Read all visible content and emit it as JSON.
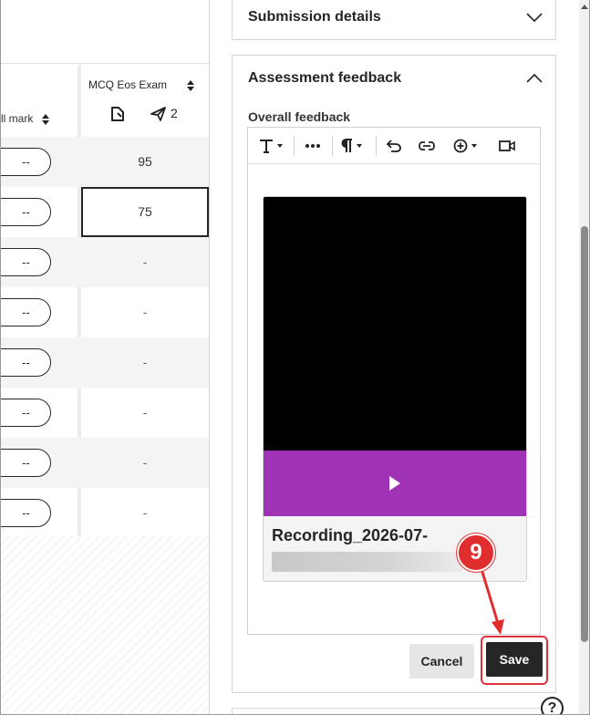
{
  "grid": {
    "overall_col_header": "ll mark",
    "mcq_col_header": "MCQ Eos Exam",
    "submissions_count": "2",
    "rows": [
      {
        "overall": "--",
        "mcq": "95"
      },
      {
        "overall": "--",
        "mcq": "75"
      },
      {
        "overall": "--",
        "mcq": "-"
      },
      {
        "overall": "--",
        "mcq": "-"
      },
      {
        "overall": "--",
        "mcq": "-"
      },
      {
        "overall": "--",
        "mcq": "-"
      },
      {
        "overall": "--",
        "mcq": "-"
      },
      {
        "overall": "--",
        "mcq": "-"
      }
    ]
  },
  "panel": {
    "submission_details_title": "Submission details",
    "assessment_feedback_title": "Assessment feedback",
    "overall_feedback_label": "Overall feedback",
    "toolbar_icons": [
      "text-format-icon",
      "more-icon",
      "paragraph-icon",
      "undo-icon",
      "link-icon",
      "insert-icon",
      "record-video-icon"
    ],
    "recording_name": "Recording_2026-07-",
    "cancel_label": "Cancel",
    "save_label": "Save",
    "help_label": "?"
  },
  "annotation": {
    "step_number": "9",
    "color": "#e02e2e"
  },
  "colors": {
    "video_bar": "#a033b5",
    "save_button": "#262626",
    "highlight": "#e0323c"
  }
}
